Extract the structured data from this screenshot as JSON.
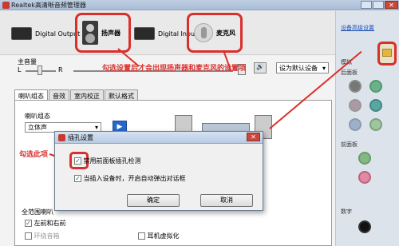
{
  "window": {
    "title": "Realtek高清晰音频管理器"
  },
  "devices": {
    "digital_output": "Digital Output",
    "speaker": "扬声器",
    "digital_input": "Digital Input",
    "microphone": "麦克风"
  },
  "right_panel": {
    "advanced_link": "设备高级设置",
    "analog": "模拟",
    "rear_panel": "后面板",
    "front_panel": "前面板",
    "digital": "数字"
  },
  "main": {
    "master_volume": "主音量",
    "left": "L",
    "right": "R",
    "default_device_select": "设为默认设备",
    "tabs": [
      "喇叭组态",
      "音效",
      "室内校正",
      "默认格式"
    ],
    "speaker_config_label": "喇叭组态",
    "speaker_config_value": "立体声",
    "full_range_label": "全范围喇叭",
    "front_lr": "左前和右前",
    "surround": "环绕音箱",
    "headphone_virtualization": "耳机虚拟化"
  },
  "annotations": {
    "top": "勾选设置后才会出现扬声器和麦克风的设置项",
    "left": "勾选此项"
  },
  "dialog": {
    "title": "插孔设置",
    "option1": "禁用前面板插孔检测",
    "option2": "当插入设备时，开启自动弹出对话框",
    "ok": "确定",
    "cancel": "取消"
  },
  "colors": {
    "annotation_red": "#d9302c",
    "link_blue": "#1b4fb8"
  }
}
